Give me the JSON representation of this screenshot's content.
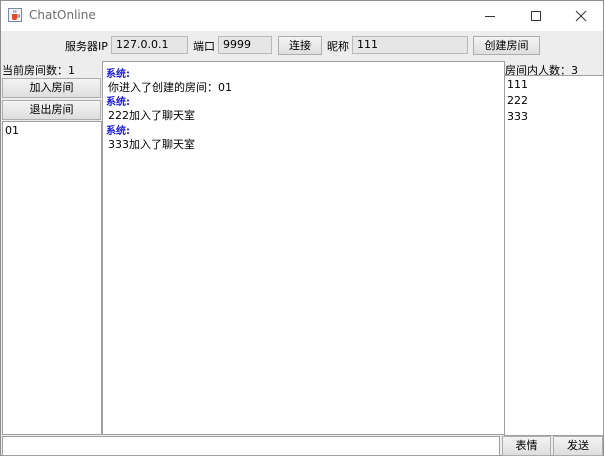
{
  "window": {
    "title": "ChatOnline"
  },
  "toolbar": {
    "server_ip_label": "服务器IP",
    "server_ip_value": "127.0.0.1",
    "port_label": "端口",
    "port_value": "9999",
    "connect_label": "连接",
    "nickname_label": "昵称",
    "nickname_value": "111",
    "create_room_label": "创建房间"
  },
  "left_panel": {
    "room_count_label": "当前房间数：1",
    "join_room_label": "加入房间",
    "leave_room_label": "退出房间",
    "rooms": [
      "01"
    ]
  },
  "chat": {
    "messages": [
      {
        "sender": "系统:",
        "text": "你进入了创建的房间：01"
      },
      {
        "sender": "系统:",
        "text": "222加入了聊天室"
      },
      {
        "sender": "系统:",
        "text": "333加入了聊天室"
      }
    ]
  },
  "right_panel": {
    "member_count_label": "房间内人数：3",
    "members": [
      "111",
      "222",
      "333"
    ]
  },
  "bottom": {
    "message_input_value": "",
    "emoji_label": "表情",
    "send_label": "发送"
  },
  "colors": {
    "sender": "#1a1adc",
    "window_bg": "#ededed"
  },
  "icons": {
    "app": "java-cup-icon",
    "minimize": "minimize-icon",
    "maximize": "maximize-icon",
    "close": "close-icon"
  }
}
